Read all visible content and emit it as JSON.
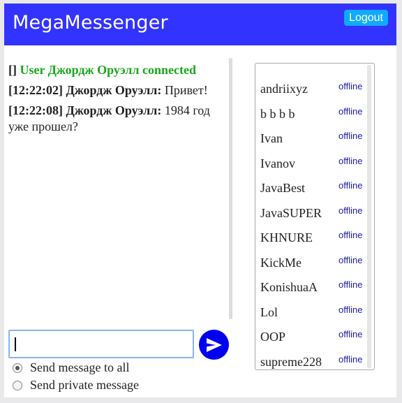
{
  "header": {
    "title": "MegaMessenger",
    "logout_label": "Logout"
  },
  "colors": {
    "header_bg": "#3333ff",
    "logout_bg": "#11aaff",
    "connected_text": "#18a81c",
    "send_button": "#0000ee",
    "status_text": "#1a1aaa"
  },
  "chat": {
    "system_message": {
      "bracket": "[]",
      "text": "User Джордж Оруэлл connected"
    },
    "messages": [
      {
        "time": "[12:22:02]",
        "author": "Джордж Оруэлл:",
        "text": "Привет!"
      },
      {
        "time": "[12:22:08]",
        "author": "Джордж Оруэлл:",
        "text": "1984 год уже прошел?"
      }
    ]
  },
  "composer": {
    "input_value": "",
    "send_icon": "send-arrow-icon",
    "options": [
      {
        "label": "Send message to all",
        "checked": true
      },
      {
        "label": "Send private message",
        "checked": false
      }
    ]
  },
  "users": [
    {
      "name": "andriixyz",
      "status": "offline"
    },
    {
      "name": "b b b b",
      "status": "offline"
    },
    {
      "name": "Ivan",
      "status": "offline"
    },
    {
      "name": "Ivanov",
      "status": "offline"
    },
    {
      "name": "JavaBest",
      "status": "offline"
    },
    {
      "name": "JavaSUPER",
      "status": "offline"
    },
    {
      "name": "KHNURE",
      "status": "offline"
    },
    {
      "name": "KickMe",
      "status": "offline"
    },
    {
      "name": "KonishuaA",
      "status": "offline"
    },
    {
      "name": "Lol",
      "status": "offline"
    },
    {
      "name": "OOP",
      "status": "offline"
    },
    {
      "name": "supreme228",
      "status": "offline"
    }
  ]
}
